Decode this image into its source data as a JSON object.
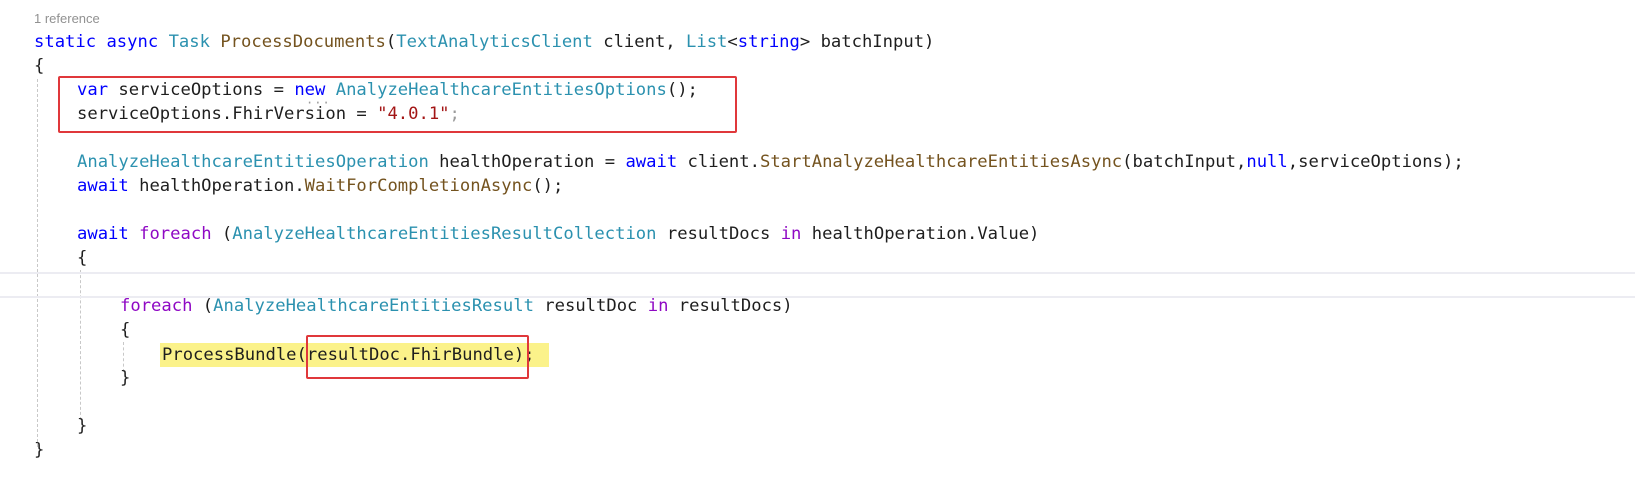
{
  "codelens": "1 reference",
  "code": {
    "l1": {
      "static": "static",
      "async": "async",
      "task": "Task",
      "method": "ProcessDocuments",
      "p_open": "(",
      "client_type": "TextAnalyticsClient",
      "client": " client, ",
      "list": "List",
      "lt": "<",
      "string": "string",
      "rest": "> batchInput)"
    },
    "l2": "{",
    "l3": {
      "var": "var",
      "a": " serviceOptions = ",
      "new": "new",
      "sp": " ",
      "type": "AnalyzeHealthcareEntitiesOptions",
      "b": "();"
    },
    "l4": {
      "a": "serviceOptions.FhirVersion = ",
      "str": "\"4.0.1\"",
      "semi": ";"
    },
    "l5": {
      "type": "AnalyzeHealthcareEntitiesOperation",
      "a": " healthOperation = ",
      "await": "await",
      "b": " client.",
      "method": "StartAnalyzeHealthcareEntitiesAsync",
      "c": "(batchInput,",
      "null": "null",
      "d": ",serviceOptions);"
    },
    "l6": {
      "await": "await",
      "a": " healthOperation.",
      "method": "WaitForCompletionAsync",
      "b": "();"
    },
    "l7": {
      "await": "await",
      "sp": " ",
      "foreach": "foreach",
      "a": " (",
      "type": "AnalyzeHealthcareEntitiesResultCollection",
      "b": " resultDocs ",
      "in": "in",
      "c": " healthOperation.Value)"
    },
    "l8": "{",
    "l9": {
      "foreach": "foreach",
      "a": " (",
      "type": "AnalyzeHealthcareEntitiesResult",
      "b": " resultDoc ",
      "in": "in",
      "c": " resultDocs)"
    },
    "l10": "{",
    "l11": {
      "method": "ProcessBundle",
      "a": "(resultDoc.FhirBundle);"
    },
    "l12": "}",
    "l13": "}",
    "l14": "}"
  }
}
